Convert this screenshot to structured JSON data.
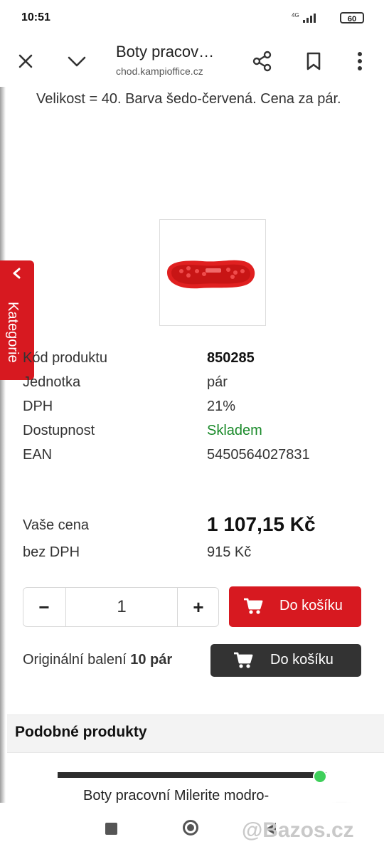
{
  "status_bar": {
    "time": "10:51",
    "network": "4G",
    "battery": "60"
  },
  "toolbar": {
    "title": "Boty pracov…",
    "url": "chod.kampioffice.cz"
  },
  "product": {
    "description": "Velikost = 40. Barva šedo-červená. Cena za pár.",
    "image_icon": "sole-red-image"
  },
  "category_tab": {
    "label": "Kategorie"
  },
  "specs": [
    {
      "label": "Kód produktu",
      "value": "850285"
    },
    {
      "label": "Jednotka",
      "value": "pár"
    },
    {
      "label": "DPH",
      "value": "21%"
    },
    {
      "label": "Dostupnost",
      "value": "Skladem"
    },
    {
      "label": "EAN",
      "value": "5450564027831"
    }
  ],
  "price": {
    "your_price_label": "Vaše cena",
    "your_price_value": "1 107,15 Kč",
    "without_vat_label": "bez DPH",
    "without_vat_value": "915 Kč"
  },
  "quantity": {
    "minus": "−",
    "value": "1",
    "plus": "+"
  },
  "cart": {
    "add_label": "Do košíku"
  },
  "original_pack": {
    "label": "Originální balení",
    "amount": "10 pár",
    "add_label": "Do košíku"
  },
  "similar": {
    "title": "Podobné produkty",
    "next_product": "Boty pracovní Milerite modro-"
  },
  "watermark": "@Bazos.cz",
  "colors": {
    "accent": "#d71920",
    "dark_button": "#333333",
    "stock_green": "#1a8a2a"
  }
}
